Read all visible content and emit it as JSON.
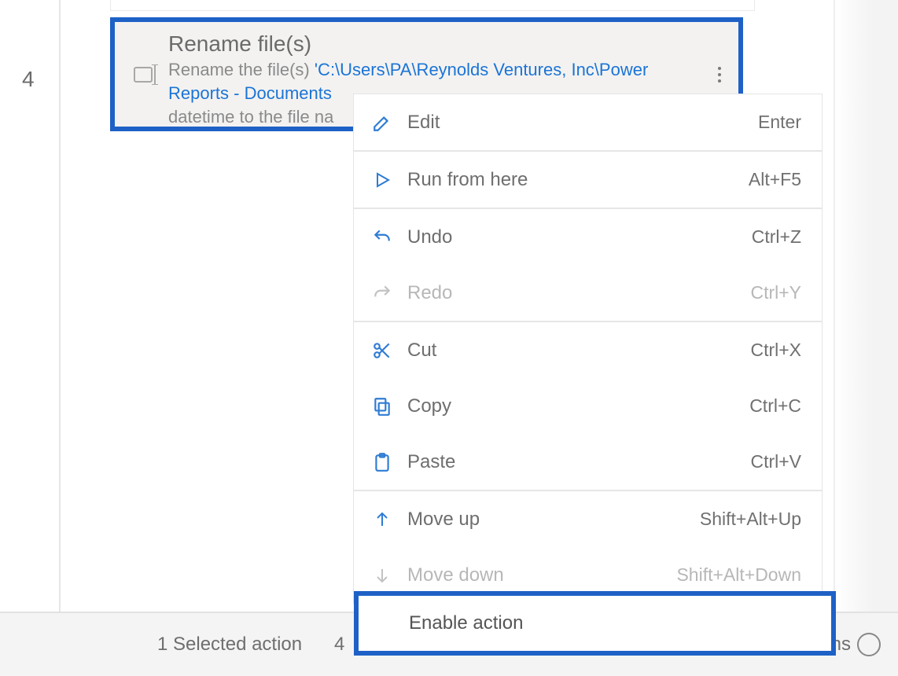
{
  "step": {
    "number": "4"
  },
  "action": {
    "title": "Rename file(s)",
    "desc_prefix": "Rename the file(s) ",
    "desc_path": "'C:\\Users\\PA\\Reynolds Ventures, Inc\\Power Reports - Documents",
    "desc_suffix": "datetime to the file na"
  },
  "menu": {
    "edit": {
      "label": "Edit",
      "shortcut": "Enter"
    },
    "run": {
      "label": "Run from here",
      "shortcut": "Alt+F5"
    },
    "undo": {
      "label": "Undo",
      "shortcut": "Ctrl+Z"
    },
    "redo": {
      "label": "Redo",
      "shortcut": "Ctrl+Y"
    },
    "cut": {
      "label": "Cut",
      "shortcut": "Ctrl+X"
    },
    "copy": {
      "label": "Copy",
      "shortcut": "Ctrl+C"
    },
    "paste": {
      "label": "Paste",
      "shortcut": "Ctrl+V"
    },
    "moveup": {
      "label": "Move up",
      "shortcut": "Shift+Alt+Up"
    },
    "movedown": {
      "label": "Move down",
      "shortcut": "Shift+Alt+Down"
    },
    "enable": {
      "label": "Enable action",
      "shortcut": ""
    }
  },
  "status": {
    "selection": "1 Selected action",
    "count": "4",
    "ms_label": "ms"
  }
}
